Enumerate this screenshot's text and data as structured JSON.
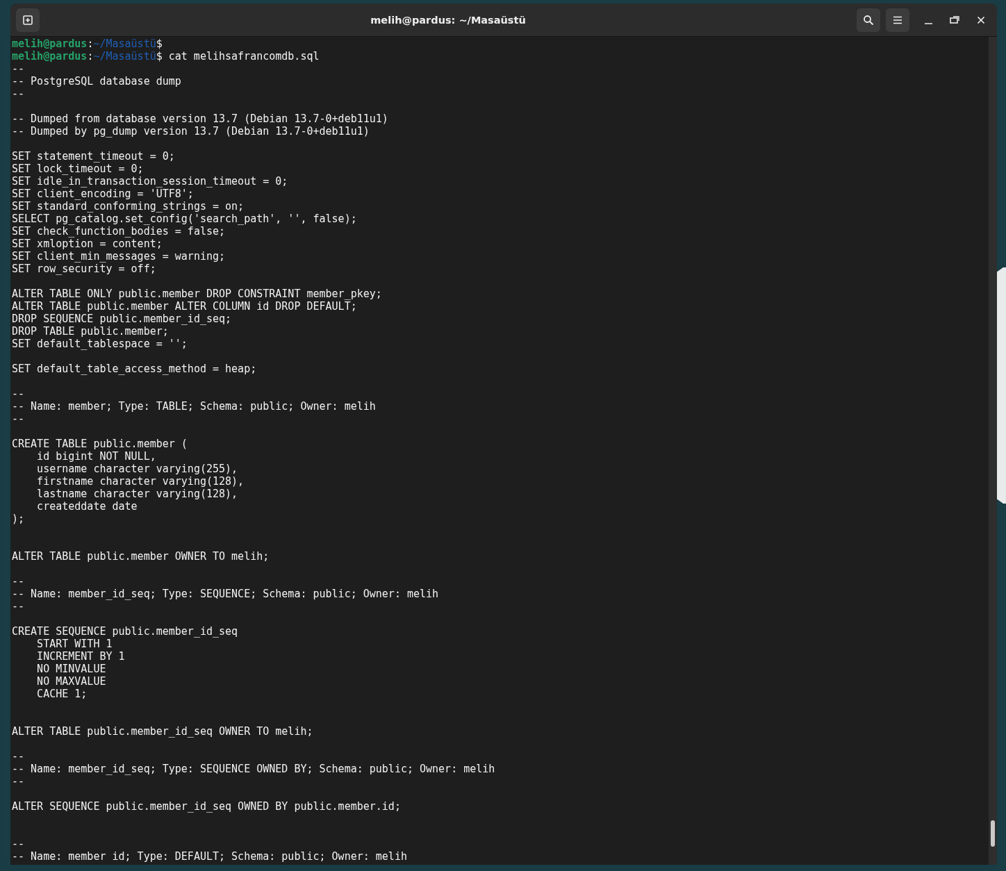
{
  "window": {
    "title": "melih@pardus: ~/Masaüstü"
  },
  "terminal": {
    "lines": [
      {
        "kind": "prompt",
        "user": "melih@pardus",
        "sep": ":",
        "path": "~/Masaüstü",
        "symbol": "$"
      },
      {
        "kind": "prompt",
        "user": "melih@pardus",
        "sep": ":",
        "path": "~/Masaüstü",
        "symbol": "$",
        "command": "cat melihsafrancomdb.sql"
      },
      {
        "kind": "text",
        "text": "--"
      },
      {
        "kind": "text",
        "text": "-- PostgreSQL database dump"
      },
      {
        "kind": "text",
        "text": "--"
      },
      {
        "kind": "blank"
      },
      {
        "kind": "text",
        "text": "-- Dumped from database version 13.7 (Debian 13.7-0+deb11u1)"
      },
      {
        "kind": "text",
        "text": "-- Dumped by pg_dump version 13.7 (Debian 13.7-0+deb11u1)"
      },
      {
        "kind": "blank"
      },
      {
        "kind": "text",
        "text": "SET statement_timeout = 0;"
      },
      {
        "kind": "text",
        "text": "SET lock_timeout = 0;"
      },
      {
        "kind": "text",
        "text": "SET idle_in_transaction_session_timeout = 0;"
      },
      {
        "kind": "text",
        "text": "SET client_encoding = 'UTF8';"
      },
      {
        "kind": "text",
        "text": "SET standard_conforming_strings = on;"
      },
      {
        "kind": "text",
        "text": "SELECT pg_catalog.set_config('search_path', '', false);"
      },
      {
        "kind": "text",
        "text": "SET check_function_bodies = false;"
      },
      {
        "kind": "text",
        "text": "SET xmloption = content;"
      },
      {
        "kind": "text",
        "text": "SET client_min_messages = warning;"
      },
      {
        "kind": "text",
        "text": "SET row_security = off;"
      },
      {
        "kind": "blank"
      },
      {
        "kind": "text",
        "text": "ALTER TABLE ONLY public.member DROP CONSTRAINT member_pkey;"
      },
      {
        "kind": "text",
        "text": "ALTER TABLE public.member ALTER COLUMN id DROP DEFAULT;"
      },
      {
        "kind": "text",
        "text": "DROP SEQUENCE public.member_id_seq;"
      },
      {
        "kind": "text",
        "text": "DROP TABLE public.member;"
      },
      {
        "kind": "text",
        "text": "SET default_tablespace = '';"
      },
      {
        "kind": "blank"
      },
      {
        "kind": "text",
        "text": "SET default_table_access_method = heap;"
      },
      {
        "kind": "blank"
      },
      {
        "kind": "text",
        "text": "--"
      },
      {
        "kind": "text",
        "text": "-- Name: member; Type: TABLE; Schema: public; Owner: melih"
      },
      {
        "kind": "text",
        "text": "--"
      },
      {
        "kind": "blank"
      },
      {
        "kind": "text",
        "text": "CREATE TABLE public.member ("
      },
      {
        "kind": "text",
        "text": "    id bigint NOT NULL,"
      },
      {
        "kind": "text",
        "text": "    username character varying(255),"
      },
      {
        "kind": "text",
        "text": "    firstname character varying(128),"
      },
      {
        "kind": "text",
        "text": "    lastname character varying(128),"
      },
      {
        "kind": "text",
        "text": "    createddate date"
      },
      {
        "kind": "text",
        "text": ");"
      },
      {
        "kind": "blank"
      },
      {
        "kind": "blank"
      },
      {
        "kind": "text",
        "text": "ALTER TABLE public.member OWNER TO melih;"
      },
      {
        "kind": "blank"
      },
      {
        "kind": "text",
        "text": "--"
      },
      {
        "kind": "text",
        "text": "-- Name: member_id_seq; Type: SEQUENCE; Schema: public; Owner: melih"
      },
      {
        "kind": "text",
        "text": "--"
      },
      {
        "kind": "blank"
      },
      {
        "kind": "text",
        "text": "CREATE SEQUENCE public.member_id_seq"
      },
      {
        "kind": "text",
        "text": "    START WITH 1"
      },
      {
        "kind": "text",
        "text": "    INCREMENT BY 1"
      },
      {
        "kind": "text",
        "text": "    NO MINVALUE"
      },
      {
        "kind": "text",
        "text": "    NO MAXVALUE"
      },
      {
        "kind": "text",
        "text": "    CACHE 1;"
      },
      {
        "kind": "blank"
      },
      {
        "kind": "blank"
      },
      {
        "kind": "text",
        "text": "ALTER TABLE public.member_id_seq OWNER TO melih;"
      },
      {
        "kind": "blank"
      },
      {
        "kind": "text",
        "text": "--"
      },
      {
        "kind": "text",
        "text": "-- Name: member_id_seq; Type: SEQUENCE OWNED BY; Schema: public; Owner: melih"
      },
      {
        "kind": "text",
        "text": "--"
      },
      {
        "kind": "blank"
      },
      {
        "kind": "text",
        "text": "ALTER SEQUENCE public.member_id_seq OWNED BY public.member.id;"
      },
      {
        "kind": "blank"
      },
      {
        "kind": "blank"
      },
      {
        "kind": "text",
        "text": "--"
      },
      {
        "kind": "text",
        "text": "-- Name: member id; Type: DEFAULT; Schema: public; Owner: melih"
      }
    ]
  }
}
